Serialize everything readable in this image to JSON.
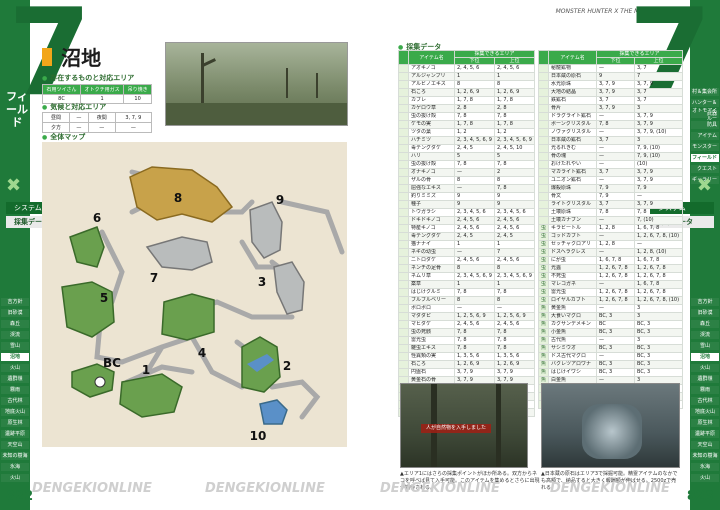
{
  "header": {
    "series_title": "MONSTER HUNTER X THE MASTER GUIDE"
  },
  "chapter_digit": "7",
  "section_vertical": "フィールド",
  "tabs": {
    "system": "システム",
    "gather": "採集データ"
  },
  "left_nav": [
    "吉方針",
    "旧砂漠",
    "森丘",
    "渓流",
    "雪山",
    "沼地",
    "火山",
    "遺群嶺",
    "霧雨",
    "古代林",
    "地底火山",
    "原生林",
    "遺跡平原",
    "天空山",
    "未知の樹海",
    "氷海",
    "火山",
    "溶岩島",
    "禁足地",
    "闘技場",
    "決戦場"
  ],
  "left_nav_active": 5,
  "right_nav": [
    "村＆集会所",
    "ハンター＆オトモアイルー",
    "武器",
    "防具",
    "アイテム",
    "モンスター",
    "フィールド",
    "クエスト",
    "ギャラリー"
  ],
  "right_nav_active": 6,
  "page_numbers": {
    "left": "822",
    "right": "823"
  },
  "area": {
    "name": "沼地"
  },
  "monster_section": {
    "heading": "存在するものと対応エリア",
    "headers": [
      "石用ツイさん",
      "オトクチ用ガス",
      "吊り焼き"
    ],
    "row": [
      "8C",
      "1",
      "10"
    ]
  },
  "climate_section": {
    "heading": "気候と対応エリア",
    "rows": [
      [
        "昼間",
        "—",
        "夜間",
        "3, 7, 9"
      ],
      [
        "夕方",
        "—",
        "—",
        "—"
      ]
    ]
  },
  "map_section": {
    "heading": "全体マップ",
    "labels": [
      "1",
      "2",
      "3",
      "4",
      "5",
      "6",
      "7",
      "8",
      "9",
      "10",
      "BC"
    ]
  },
  "gather_section": {
    "heading": "採集データ",
    "col_item": "アイテム名",
    "col_group": "採集できるエリア",
    "col_low": "下位",
    "col_high": "上位",
    "left_table": [
      {
        "kind": "",
        "item": "アオキノコ",
        "low": "2, 4, 5, 6",
        "high": "2, 4, 5, 6"
      },
      {
        "kind": "",
        "item": "アルジャンブリ",
        "low": "1",
        "high": "1"
      },
      {
        "kind": "",
        "item": "アルビノエキス",
        "low": "8",
        "high": "8"
      },
      {
        "kind": "",
        "item": "石ころ",
        "low": "1, 2, 6, 9",
        "high": "1, 2, 6, 9"
      },
      {
        "kind": "",
        "item": "カブレ",
        "low": "1, 7, 8",
        "high": "1, 7, 8"
      },
      {
        "kind": "",
        "item": "カゲロウ草",
        "low": "2, 8",
        "high": "2, 8"
      },
      {
        "kind": "",
        "item": "虫の抜け殻",
        "low": "7, 8",
        "high": "7, 8"
      },
      {
        "kind": "",
        "item": "ケモの実",
        "low": "1, 7, 8",
        "high": "1, 7, 8"
      },
      {
        "kind": "",
        "item": "ツタの葉",
        "low": "1, 2",
        "high": "1, 2"
      },
      {
        "kind": "",
        "item": "ハチミツ",
        "low": "2, 3, 4, 5, 6, 9",
        "high": "2, 3, 4, 5, 6, 9"
      },
      {
        "kind": "",
        "item": "毒テングダケ",
        "low": "2, 4, 5",
        "high": "2, 4, 5, 10"
      },
      {
        "kind": "",
        "item": "ハリ",
        "low": "5",
        "high": "5"
      },
      {
        "kind": "",
        "item": "虫の抜け殻",
        "low": "7, 8",
        "high": "7, 8"
      },
      {
        "kind": "",
        "item": "オナキノコ",
        "low": "—",
        "high": "2"
      },
      {
        "kind": "",
        "item": "ザルの骨",
        "low": "8",
        "high": "8"
      },
      {
        "kind": "",
        "item": "屈強なエキス",
        "low": "—",
        "high": "7, 8"
      },
      {
        "kind": "",
        "item": "釣りミミズ",
        "low": "9",
        "high": "9"
      },
      {
        "kind": "",
        "item": "種子",
        "low": "9",
        "high": "9"
      },
      {
        "kind": "",
        "item": "トウガラシ",
        "low": "2, 3, 4, 5, 6",
        "high": "2, 3, 4, 5, 6"
      },
      {
        "kind": "",
        "item": "ドキドキノコ",
        "low": "2, 4, 5, 6",
        "high": "2, 4, 5, 6"
      },
      {
        "kind": "",
        "item": "特産キノコ",
        "low": "2, 4, 5, 6",
        "high": "2, 4, 5, 6"
      },
      {
        "kind": "",
        "item": "毒テングダケ",
        "low": "2, 4, 5",
        "high": "2, 4, 5"
      },
      {
        "kind": "",
        "item": "猫ナナイ",
        "low": "1",
        "high": "1"
      },
      {
        "kind": "",
        "item": "ネギの幼虫",
        "low": "—",
        "high": "7"
      },
      {
        "kind": "",
        "item": "ニトロダケ",
        "low": "2, 4, 5, 6",
        "high": "2, 4, 5, 6"
      },
      {
        "kind": "",
        "item": "ネンチの足骨",
        "low": "8",
        "high": "8"
      },
      {
        "kind": "",
        "item": "ネムリ草",
        "low": "2, 3, 4, 5, 6, 9",
        "high": "2, 3, 4, 5, 6, 9"
      },
      {
        "kind": "",
        "item": "薬草",
        "low": "1",
        "high": "1"
      },
      {
        "kind": "",
        "item": "はじけクルミ",
        "low": "7, 8",
        "high": "7, 8"
      },
      {
        "kind": "",
        "item": "ブルブルベリー",
        "low": "8",
        "high": "8"
      },
      {
        "kind": "",
        "item": "ボロボロ",
        "low": "—",
        "high": "—"
      },
      {
        "kind": "",
        "item": "マダダピ",
        "low": "1, 2, 5, 6, 9",
        "high": "1, 2, 5, 6, 9"
      },
      {
        "kind": "",
        "item": "マヒダケ",
        "low": "2, 4, 5, 6",
        "high": "2, 4, 5, 6"
      },
      {
        "kind": "",
        "item": "虫の死骸",
        "low": "7, 8",
        "high": "7, 8"
      },
      {
        "kind": "",
        "item": "雷光虫",
        "low": "7, 8",
        "high": "7, 8"
      },
      {
        "kind": "",
        "item": "雑虫エキス",
        "low": "7, 8",
        "high": "7, 8"
      },
      {
        "kind": "",
        "item": "怪異類の実",
        "low": "1, 3, 5, 6",
        "high": "1, 3, 5, 6"
      },
      {
        "kind": "",
        "item": "石ころ",
        "low": "1, 2, 6, 9",
        "high": "1, 2, 6, 9"
      },
      {
        "kind": "",
        "item": "円盤石",
        "low": "3, 7, 9",
        "high": "3, 7, 9"
      },
      {
        "kind": "",
        "item": "黄金石の骨",
        "low": "3, 7, 9",
        "high": "3, 7, 9"
      },
      {
        "kind": "",
        "item": "骨の骨",
        "low": "—",
        "high": "3, 7, 9, (10)"
      },
      {
        "kind": "",
        "item": "カブレライト鉱石",
        "low": "—",
        "high": "3, 7, 9, (10)"
      },
      {
        "kind": "",
        "item": "秘骨片",
        "low": "—",
        "high": "7, 9, (10)"
      },
      {
        "kind": "",
        "item": "さびた骨",
        "low": "—",
        "high": "7, 9, (10)"
      }
    ],
    "right_table": [
      {
        "kind": "",
        "item": "秘龍鉱物",
        "low": "—",
        "high": "3, 7"
      },
      {
        "kind": "",
        "item": "日本蔵の原石",
        "low": "9",
        "high": "7"
      },
      {
        "kind": "",
        "item": "水光原珠",
        "low": "3, 7, 9",
        "high": "3, 7, 9"
      },
      {
        "kind": "",
        "item": "大地の結晶",
        "low": "3, 7, 9",
        "high": "3, 7"
      },
      {
        "kind": "",
        "item": "鉄鉱石",
        "low": "3, 7",
        "high": "3, 7"
      },
      {
        "kind": "",
        "item": "骨片",
        "low": "3, 7, 9",
        "high": "3"
      },
      {
        "kind": "",
        "item": "ドラグライト鉱石",
        "low": "—",
        "high": "3, 7, 9"
      },
      {
        "kind": "",
        "item": "ボーンクリスタル",
        "low": "7, 8",
        "high": "3, 7, 9"
      },
      {
        "kind": "",
        "item": "ノヴァクリスタル",
        "low": "—",
        "high": "3, 7, 9, (10)"
      },
      {
        "kind": "",
        "item": "日本蔵の鉱石",
        "low": "3, 7",
        "high": "3"
      },
      {
        "kind": "",
        "item": "光るれきむ",
        "low": "—",
        "high": "7, 9, (10)"
      },
      {
        "kind": "",
        "item": "骨の塊",
        "low": "—",
        "high": "7, 9, (10)"
      },
      {
        "kind": "",
        "item": "おけたれやい",
        "low": "—",
        "high": "(10)"
      },
      {
        "kind": "",
        "item": "マカライト鉱石",
        "low": "3, 7",
        "high": "3, 7, 9"
      },
      {
        "kind": "",
        "item": "ユニオン鉱石",
        "low": "—",
        "high": "3, 7, 9"
      },
      {
        "kind": "",
        "item": "爆殺原珠",
        "low": "7, 9",
        "high": "7, 9"
      },
      {
        "kind": "",
        "item": "骨文",
        "low": "7, 9",
        "high": "—"
      },
      {
        "kind": "",
        "item": "ライトクリスタル",
        "low": "3, 7",
        "high": "3, 7, 9"
      },
      {
        "kind": "",
        "item": "土壊原珠",
        "low": "7, 8",
        "high": "7, 8"
      },
      {
        "kind": "",
        "item": "土壊カナブン",
        "low": "—",
        "high": "7, (10)"
      },
      {
        "kind": "虫",
        "item": "キラビートル",
        "low": "1, 2, 8",
        "high": "1, 6, 7, 8"
      },
      {
        "kind": "虫",
        "item": "ゴッドカブト",
        "low": "—",
        "high": "1, 2, 6, 7, 8, (10)"
      },
      {
        "kind": "虫",
        "item": "セッチャクロアリ",
        "low": "1, 2, 8",
        "high": "—"
      },
      {
        "kind": "虫",
        "item": "ドスヘラクレス",
        "low": "—",
        "high": "1, 2, 8, (10)"
      },
      {
        "kind": "虫",
        "item": "にが虫",
        "low": "1, 6, 7, 8",
        "high": "1, 6, 7, 8"
      },
      {
        "kind": "虫",
        "item": "光蟲",
        "low": "1, 2, 6, 7, 8",
        "high": "1, 2, 6, 7, 8"
      },
      {
        "kind": "虫",
        "item": "不死虫",
        "low": "1, 2, 6, 7, 8",
        "high": "1, 2, 6, 7, 8"
      },
      {
        "kind": "虫",
        "item": "マレコガネ",
        "low": "—",
        "high": "1, 6, 7, 8"
      },
      {
        "kind": "虫",
        "item": "雷光虫",
        "low": "1, 2, 6, 7, 8",
        "high": "1, 2, 6, 7, 8"
      },
      {
        "kind": "虫",
        "item": "ロイヤルカブト",
        "low": "1, 2, 6, 7, 8",
        "high": "1, 2, 6, 7, 8, (10)"
      },
      {
        "kind": "魚",
        "item": "黄金魚",
        "low": "—",
        "high": "3"
      },
      {
        "kind": "魚",
        "item": "大食いマグロ",
        "low": "BC, 3",
        "high": "3"
      },
      {
        "kind": "魚",
        "item": "カクサンデメキン",
        "low": "BC",
        "high": "BC, 3"
      },
      {
        "kind": "魚",
        "item": "小金魚",
        "low": "BC, 3",
        "high": "BC, 3"
      },
      {
        "kind": "魚",
        "item": "古代魚",
        "low": "—",
        "high": "3"
      },
      {
        "kind": "魚",
        "item": "サシミウオ",
        "low": "BC, 3",
        "high": "BC, 3"
      },
      {
        "kind": "魚",
        "item": "ドス古代マグロ",
        "low": "—",
        "high": "BC, 3"
      },
      {
        "kind": "魚",
        "item": "バクレツアロワナ",
        "low": "BC, 3",
        "high": "BC, 3"
      },
      {
        "kind": "魚",
        "item": "はじけイワシ",
        "low": "BC, 3",
        "high": "BC, 3"
      },
      {
        "kind": "魚",
        "item": "白金魚",
        "low": "—",
        "high": "3"
      },
      {
        "kind": "魚",
        "item": "ハリマグロ",
        "low": "BC, 3",
        "high": "BC, 3"
      },
      {
        "kind": "魚",
        "item": "バレットアロワナ",
        "low": "BC, 3",
        "high": "BC, 3"
      },
      {
        "kind": "魚",
        "item": "眠魚",
        "low": "BC, 3",
        "high": "BC, 3"
      }
    ]
  },
  "screenshots": {
    "left_banner": "人が自然物を入手しました",
    "left_caption": "▲エリア1にはさらの採集ポイントがほか所ある。双方からネコを呼べば見て入手可能。このアイテムを集めるとさらに出現が期待される。",
    "right_caption": "▲日本蔵の原石はエリア3で採掘可能。精霊アイテムのなかでも高額で、納品すると大きく報酬額が伸ばせる。2500zで売れる。"
  },
  "watermark": "DENGEKIONLINE"
}
